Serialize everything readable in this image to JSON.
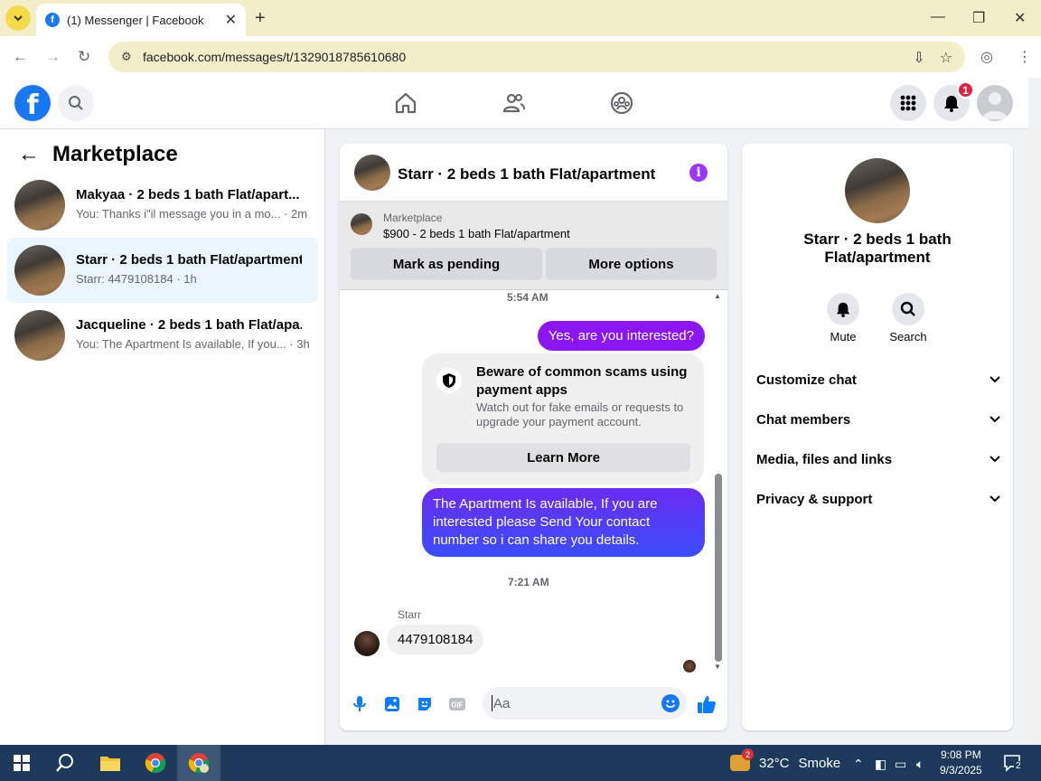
{
  "browser": {
    "tab_title": "(1) Messenger | Facebook",
    "url": "facebook.com/messages/t/1329018785610680"
  },
  "header": {
    "notification_count": "1"
  },
  "left_panel": {
    "title": "Marketplace",
    "conversations": [
      {
        "name": "Makyaa · 2 beds 1 bath Flat/apart...",
        "preview": "You: Thanks i\"il message you in a mo...",
        "time": "· 2m",
        "active": false
      },
      {
        "name": "Starr · 2 beds 1 bath Flat/apartment",
        "preview": "Starr: 4479108184",
        "time": "· 1h",
        "active": true
      },
      {
        "name": "Jacqueline · 2 beds 1 bath Flat/apa...",
        "preview": "You: The Apartment Is available, If you...",
        "time": "· 3h",
        "active": false
      }
    ]
  },
  "chat": {
    "title": "Starr · 2 beds 1 bath Flat/apartment",
    "marketplace": {
      "label": "Marketplace",
      "listing": "$900 - 2 beds 1 bath Flat/apartment",
      "pending_button": "Mark as pending",
      "options_button": "More options"
    },
    "messages": {
      "time1": "5:54 AM",
      "out1": "Yes, are you interested?",
      "scam_title": "Beware of common scams using payment apps",
      "scam_desc": "Watch out for fake emails or requests to upgrade your payment account.",
      "learn_more": "Learn More",
      "out2": "The Apartment Is available, If you are interested please Send Your contact number so i can share you details.",
      "time2": "7:21 AM",
      "sender": "Starr",
      "in1": "4479108184"
    },
    "composer_placeholder": "Aa"
  },
  "right_panel": {
    "name": "Starr · 2 beds 1 bath Flat/apartment",
    "mute_label": "Mute",
    "search_label": "Search",
    "sections": [
      "Customize chat",
      "Chat members",
      "Media, files and links",
      "Privacy & support"
    ]
  },
  "taskbar": {
    "weather_temp": "32°C",
    "weather_desc": "Smoke",
    "weather_badge": "2",
    "time": "9:08 PM",
    "date": "9/3/2025",
    "notif_count": "2"
  }
}
